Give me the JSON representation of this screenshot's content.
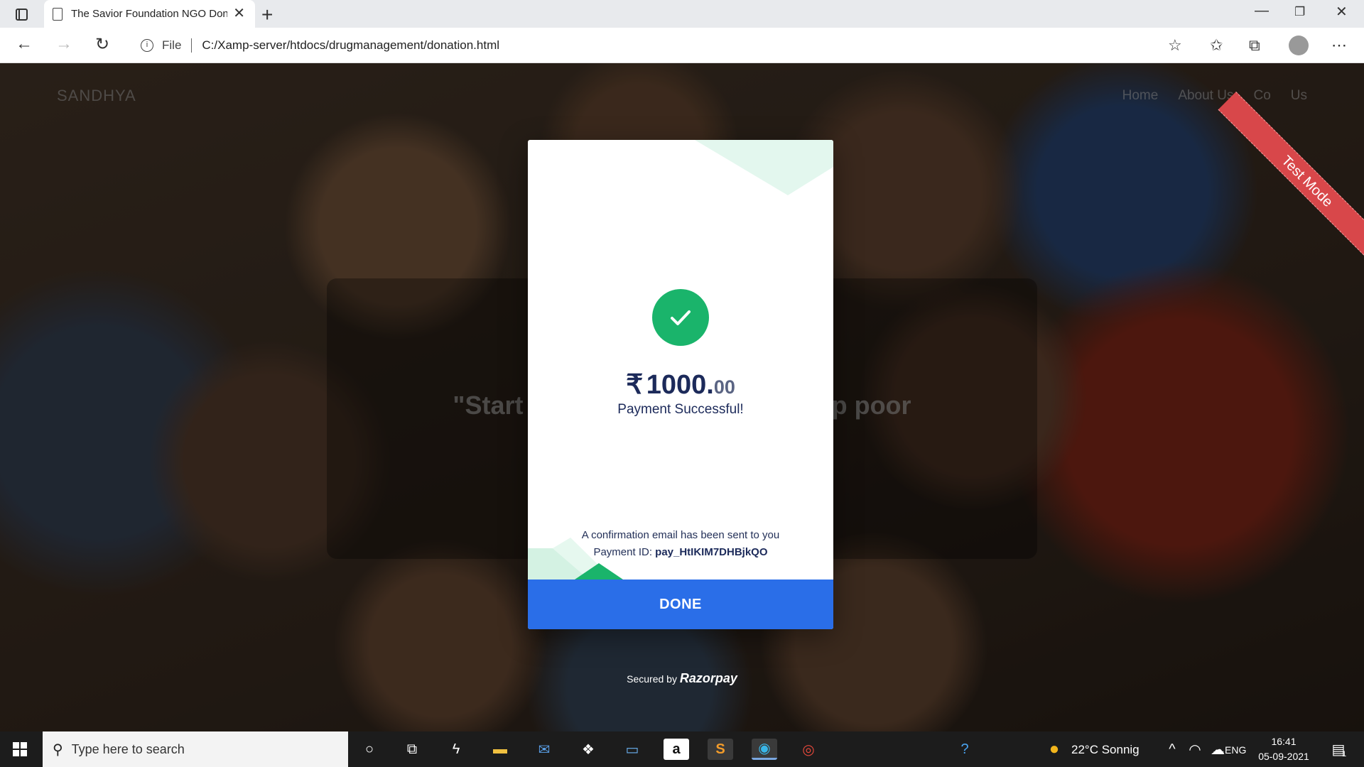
{
  "browser": {
    "tab_title": "The Savior Foundation NGO Dona",
    "address_label": "File",
    "url": "C:/Xamp-server/htdocs/drugmanagement/donation.html"
  },
  "site": {
    "brand": "SANDHYA",
    "nav": [
      "Home",
      "About Us",
      "Co",
      "Us"
    ],
    "hero_text": "\"Start Fu                                   elp poor",
    "ribbon": "Test Mode"
  },
  "payment": {
    "currency_symbol": "₹",
    "amount_whole": "1000.",
    "amount_decimal": "00",
    "status": "Payment Successful!",
    "email_notice": "A confirmation email has been sent to you",
    "payment_id_label": "Payment ID:",
    "payment_id": "pay_HtIKIM7DHBjkQO",
    "done_label": "DONE",
    "secured_by": "Secured by",
    "provider": "Razorpay",
    "colors": {
      "success": "#1ab46b",
      "button": "#2a6ee8",
      "ribbon": "#d8474a"
    }
  },
  "taskbar": {
    "search_placeholder": "Type here to search",
    "weather": "22°C  Sonnig",
    "language": "ENG",
    "time": "16:41",
    "date": "05-09-2021",
    "notification_count": "1"
  }
}
